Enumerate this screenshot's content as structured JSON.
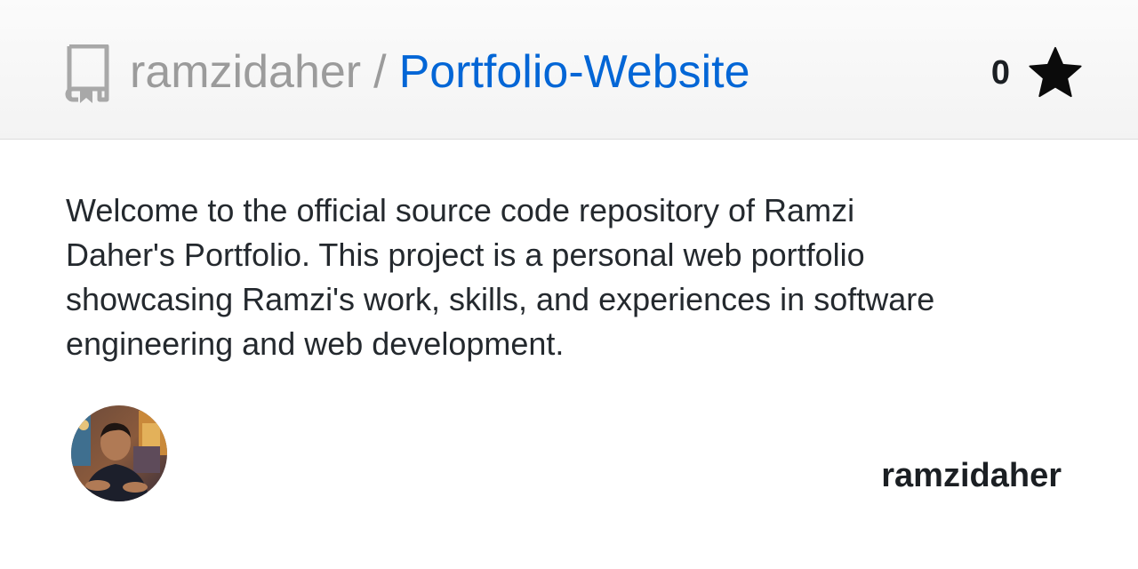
{
  "repo": {
    "owner": "ramzidaher",
    "separator": "/",
    "name": "Portfolio-Website",
    "star_count": "0",
    "description": "Welcome to the official source code repository of Ramzi Daher's Portfolio. This project is a personal web portfolio showcasing Ramzi's work, skills, and experiences in software engineering and web development."
  },
  "author": {
    "username": "ramzidaher"
  },
  "icons": {
    "repo": "repo-icon",
    "star": "star-icon",
    "avatar": "avatar-photo"
  },
  "colors": {
    "link": "#0366d6",
    "owner": "#9b9b9b",
    "text": "#24292e"
  }
}
